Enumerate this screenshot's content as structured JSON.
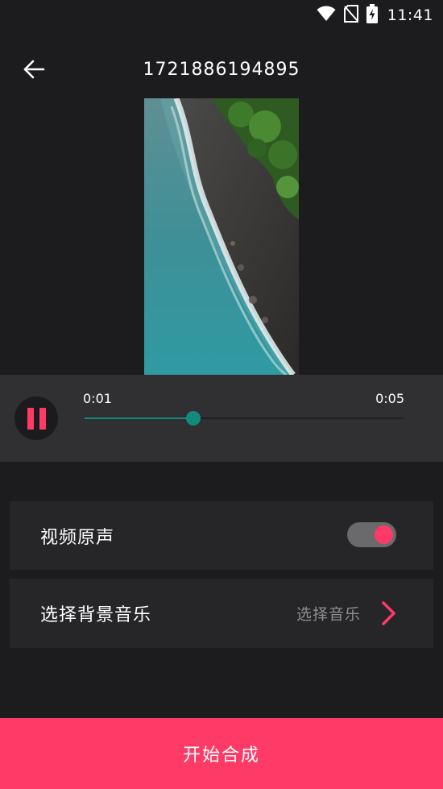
{
  "status_bar": {
    "time": "11:41",
    "icons": [
      "wifi-icon",
      "no-sim-icon",
      "battery-charging-icon"
    ]
  },
  "toolbar": {
    "back_icon": "arrow-left-icon",
    "title": "1721886194895"
  },
  "preview": {
    "content": "aerial coastline video frame"
  },
  "player": {
    "state_icon": "pause-icon",
    "current_time": "0:01",
    "total_time": "0:05",
    "progress_fraction": 0.34,
    "accent_color": "#138a7c"
  },
  "options": {
    "original_audio": {
      "label": "视频原声",
      "enabled": true
    },
    "background_music": {
      "label": "选择背景音乐",
      "value": "选择音乐",
      "chevron_icon": "chevron-right-icon"
    }
  },
  "actions": {
    "start_label": "开始合成",
    "accent_color": "#fe3a67"
  }
}
